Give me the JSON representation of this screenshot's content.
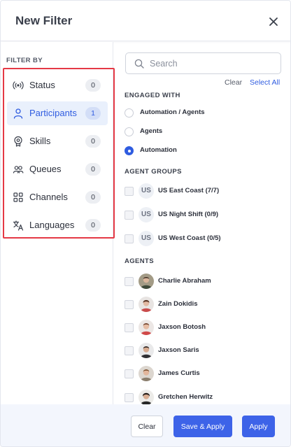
{
  "header": {
    "title": "New Filter",
    "close_icon": "close-icon"
  },
  "sidebar": {
    "heading": "FILTER BY",
    "highlight_color": "#e53945",
    "items": [
      {
        "label": "Status",
        "count": "0",
        "icon": "broadcast-icon",
        "active": false
      },
      {
        "label": "Participants",
        "count": "1",
        "icon": "person-icon",
        "active": true
      },
      {
        "label": "Skills",
        "count": "0",
        "icon": "skill-badge-icon",
        "active": false
      },
      {
        "label": "Queues",
        "count": "0",
        "icon": "people-group-icon",
        "active": false
      },
      {
        "label": "Channels",
        "count": "0",
        "icon": "grid-squares-icon",
        "active": false
      },
      {
        "label": "Languages",
        "count": "0",
        "icon": "translate-icon",
        "active": false
      }
    ]
  },
  "search": {
    "placeholder": "Search",
    "value": ""
  },
  "actions": {
    "clear_label": "Clear",
    "select_all_label": "Select All"
  },
  "engaged_with": {
    "title": "ENGAGED WITH",
    "options": [
      {
        "label": "Automation / Agents",
        "selected": false
      },
      {
        "label": "Agents",
        "selected": false
      },
      {
        "label": "Automation",
        "selected": true
      }
    ]
  },
  "agent_groups": {
    "title": "AGENT GROUPS",
    "items": [
      {
        "badge": "US",
        "label": "US East Coast (7/7)",
        "checked": false
      },
      {
        "badge": "US",
        "label": "US Night Shift (0/9)",
        "checked": false
      },
      {
        "badge": "US",
        "label": "US West Coast (0/5)",
        "checked": false
      }
    ]
  },
  "agents": {
    "title": "AGENTS",
    "items": [
      {
        "name": "Charlie Abraham",
        "checked": false
      },
      {
        "name": "Zain Dokidis",
        "checked": false
      },
      {
        "name": "Jaxson Botosh",
        "checked": false
      },
      {
        "name": "Jaxson Saris",
        "checked": false
      },
      {
        "name": "James Curtis",
        "checked": false
      },
      {
        "name": "Gretchen Herwitz",
        "checked": false
      }
    ]
  },
  "footer": {
    "clear_label": "Clear",
    "save_apply_label": "Save & Apply",
    "apply_label": "Apply"
  },
  "colors": {
    "accent": "#3d63e8",
    "active_bg": "#e9f0fc",
    "footer_bg": "#f3f6fd"
  }
}
